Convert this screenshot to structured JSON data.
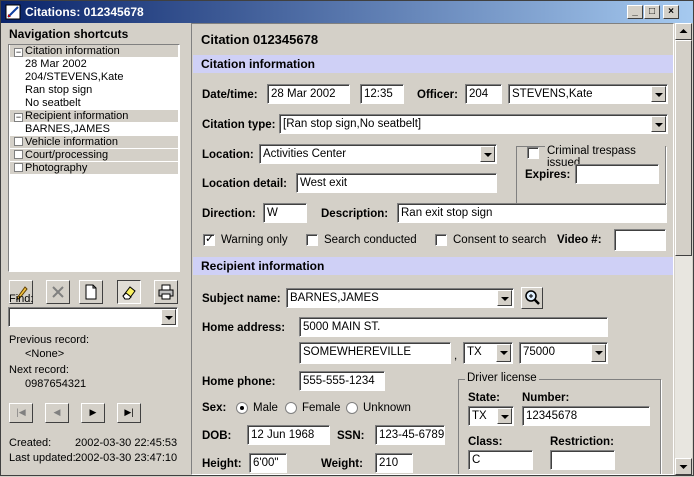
{
  "window": {
    "title": "Citations: 012345678",
    "colors": {
      "titlebar_start": "#0a246a",
      "titlebar_end": "#a6caf0",
      "section_bar": "#cfd0f6"
    }
  },
  "nav": {
    "title": "Navigation shortcuts",
    "groups": [
      {
        "label": "Citation information",
        "expanded": true,
        "items": [
          "28 Mar 2002",
          "204/STEVENS,Kate",
          "Ran stop sign",
          "No seatbelt"
        ]
      },
      {
        "label": "Recipient information",
        "expanded": true,
        "items": [
          "BARNES,JAMES"
        ]
      },
      {
        "label": "Vehicle information",
        "expanded": false,
        "items": []
      },
      {
        "label": "Court/processing",
        "expanded": false,
        "items": []
      },
      {
        "label": "Photography",
        "expanded": false,
        "items": []
      }
    ],
    "toolbar_icons": [
      "pencil-icon",
      "delete-icon",
      "new-document-icon",
      "eraser-icon",
      "printer-icon"
    ],
    "find_label": "Find:",
    "find_value": "",
    "previous_label": "Previous record:",
    "previous_value": "<None>",
    "next_label": "Next record:",
    "next_value": "0987654321",
    "created_label": "Created:",
    "created_value": "2002-03-30 22:45:53",
    "updated_label": "Last updated:",
    "updated_value": "2002-03-30 23:47:10"
  },
  "main": {
    "heading": "Citation 012345678",
    "citation": {
      "section_title": "Citation information",
      "datetime_label": "Date/time:",
      "date": "28 Mar 2002",
      "time": "12:35",
      "officer_label": "Officer:",
      "officer_id": "204",
      "officer_name": "STEVENS,Kate",
      "type_label": "Citation type:",
      "type_value": "[Ran stop sign,No seatbelt]",
      "location_label": "Location:",
      "location_value": "Activities Center",
      "trespass_label": "Criminal trespass issued",
      "expires_label": "Expires:",
      "expires_value": "",
      "location_detail_label": "Location detail:",
      "location_detail_value": "West exit",
      "direction_label": "Direction:",
      "direction_value": "W",
      "description_label": "Description:",
      "description_value": "Ran exit stop sign",
      "warning_label": "Warning only",
      "search_label": "Search conducted",
      "consent_label": "Consent to search",
      "video_label": "Video #:",
      "video_value": ""
    },
    "recipient": {
      "section_title": "Recipient information",
      "subject_label": "Subject name:",
      "subject_value": "BARNES,JAMES",
      "address_label": "Home address:",
      "address_line1": "5000 MAIN ST.",
      "city": "SOMEWHEREVILLE",
      "comma": ",",
      "state": "TX",
      "zip": "75000",
      "phone_label": "Home phone:",
      "phone_value": "555-555-1234",
      "sex_label": "Sex:",
      "sex_male": "Male",
      "sex_female": "Female",
      "sex_unknown": "Unknown",
      "dob_label": "DOB:",
      "dob_value": "12 Jun 1968",
      "ssn_label": "SSN:",
      "ssn_value": "123-45-6789",
      "height_label": "Height:",
      "height_value": "6'00\"",
      "weight_label": "Weight:",
      "weight_value": "210",
      "license": {
        "title": "Driver license",
        "state_label": "State:",
        "state_value": "TX",
        "number_label": "Number:",
        "number_value": "12345678",
        "class_label": "Class:",
        "class_value": "C",
        "restriction_label": "Restriction:",
        "restriction_value": ""
      }
    }
  }
}
